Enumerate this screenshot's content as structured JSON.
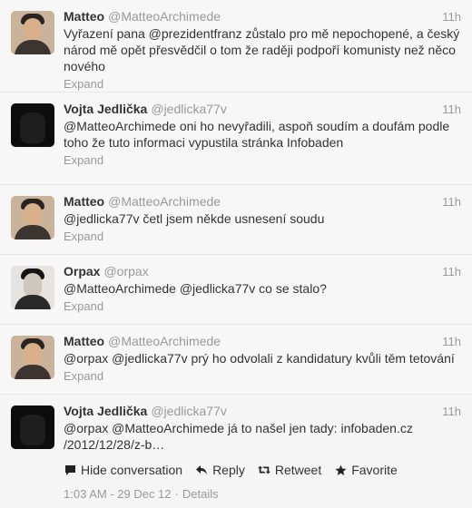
{
  "tweets": [
    {
      "fullname": "Matteo",
      "username": "@MatteoArchimede",
      "time": "11h",
      "text": "Vyřazení pana @prezidentfranz zůstalo pro mě nepochopené, a český národ mě opět přesvědčil o tom že raději podpoří komunisty než něco nového",
      "expand": "Expand",
      "avatar": "matteo"
    },
    {
      "fullname": "Vojta Jedlička",
      "username": "@jedlicka77v",
      "time": "11h",
      "text": "@MatteoArchimede oni ho nevyřadili, aspoň soudím a doufám podle toho že tuto informaci vypustila stránka Infobaden",
      "expand": "Expand",
      "avatar": "vojta"
    },
    {
      "fullname": "Matteo",
      "username": "@MatteoArchimede",
      "time": "11h",
      "text": "@jedlicka77v četl jsem někde usnesení soudu",
      "expand": "Expand",
      "avatar": "matteo"
    },
    {
      "fullname": "Orpax",
      "username": "@orpax",
      "time": "11h",
      "text": "@MatteoArchimede @jedlicka77v co se stalo?",
      "expand": "Expand",
      "avatar": "orpax"
    },
    {
      "fullname": "Matteo",
      "username": "@MatteoArchimede",
      "time": "11h",
      "text": "@orpax @jedlicka77v prý ho odvolali z kandidatury kvůli těm tetování",
      "expand": "Expand",
      "avatar": "matteo"
    }
  ],
  "expanded_tweet": {
    "fullname": "Vojta Jedlička",
    "username": "@jedlicka77v",
    "time": "11h",
    "text_line1": "@orpax @MatteoArchimede já to našel jen tady: infobaden.cz",
    "text_line2": "/2012/12/28/z-b…",
    "actions": {
      "hide": "Hide conversation",
      "reply": "Reply",
      "retweet": "Retweet",
      "favorite": "Favorite"
    },
    "meta": {
      "timestamp": "1:03 AM - 29 Dec 12",
      "separator": "·",
      "details": "Details"
    }
  },
  "icons": {
    "hide": "speech-bubble-icon",
    "reply": "reply-arrow-icon",
    "retweet": "retweet-icon",
    "favorite": "star-icon"
  }
}
